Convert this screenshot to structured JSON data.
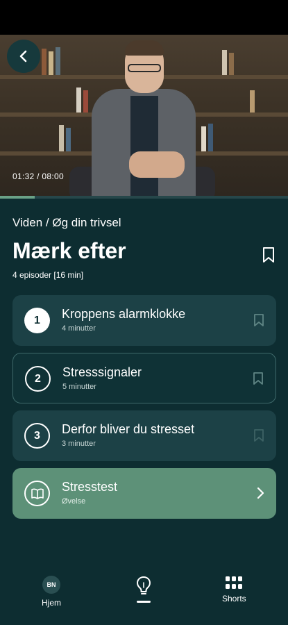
{
  "video": {
    "time_display": "01:32 / 08:00",
    "progress_fraction": 0.12
  },
  "breadcrumb": "Viden / Øg din trivsel",
  "title": "Mærk efter",
  "subtitle": "4 episoder [16 min]",
  "episodes": [
    {
      "number": "1",
      "title": "Kroppens alarmklokke",
      "meta": "4 minutter"
    },
    {
      "number": "2",
      "title": "Stresssignaler",
      "meta": "5 minutter"
    },
    {
      "number": "3",
      "title": "Derfor bliver du stresset",
      "meta": "3 minutter"
    }
  ],
  "exercise": {
    "title": "Stresstest",
    "meta": "Øvelse",
    "icon": "open-book-icon"
  },
  "nav": {
    "home_label": "Hjem",
    "avatar_initials": "BN",
    "shorts_label": "Shorts"
  },
  "colors": {
    "background": "#0d2d31",
    "card": "#1c4146",
    "accent_green": "#5d9178",
    "progress": "#6aa287"
  }
}
